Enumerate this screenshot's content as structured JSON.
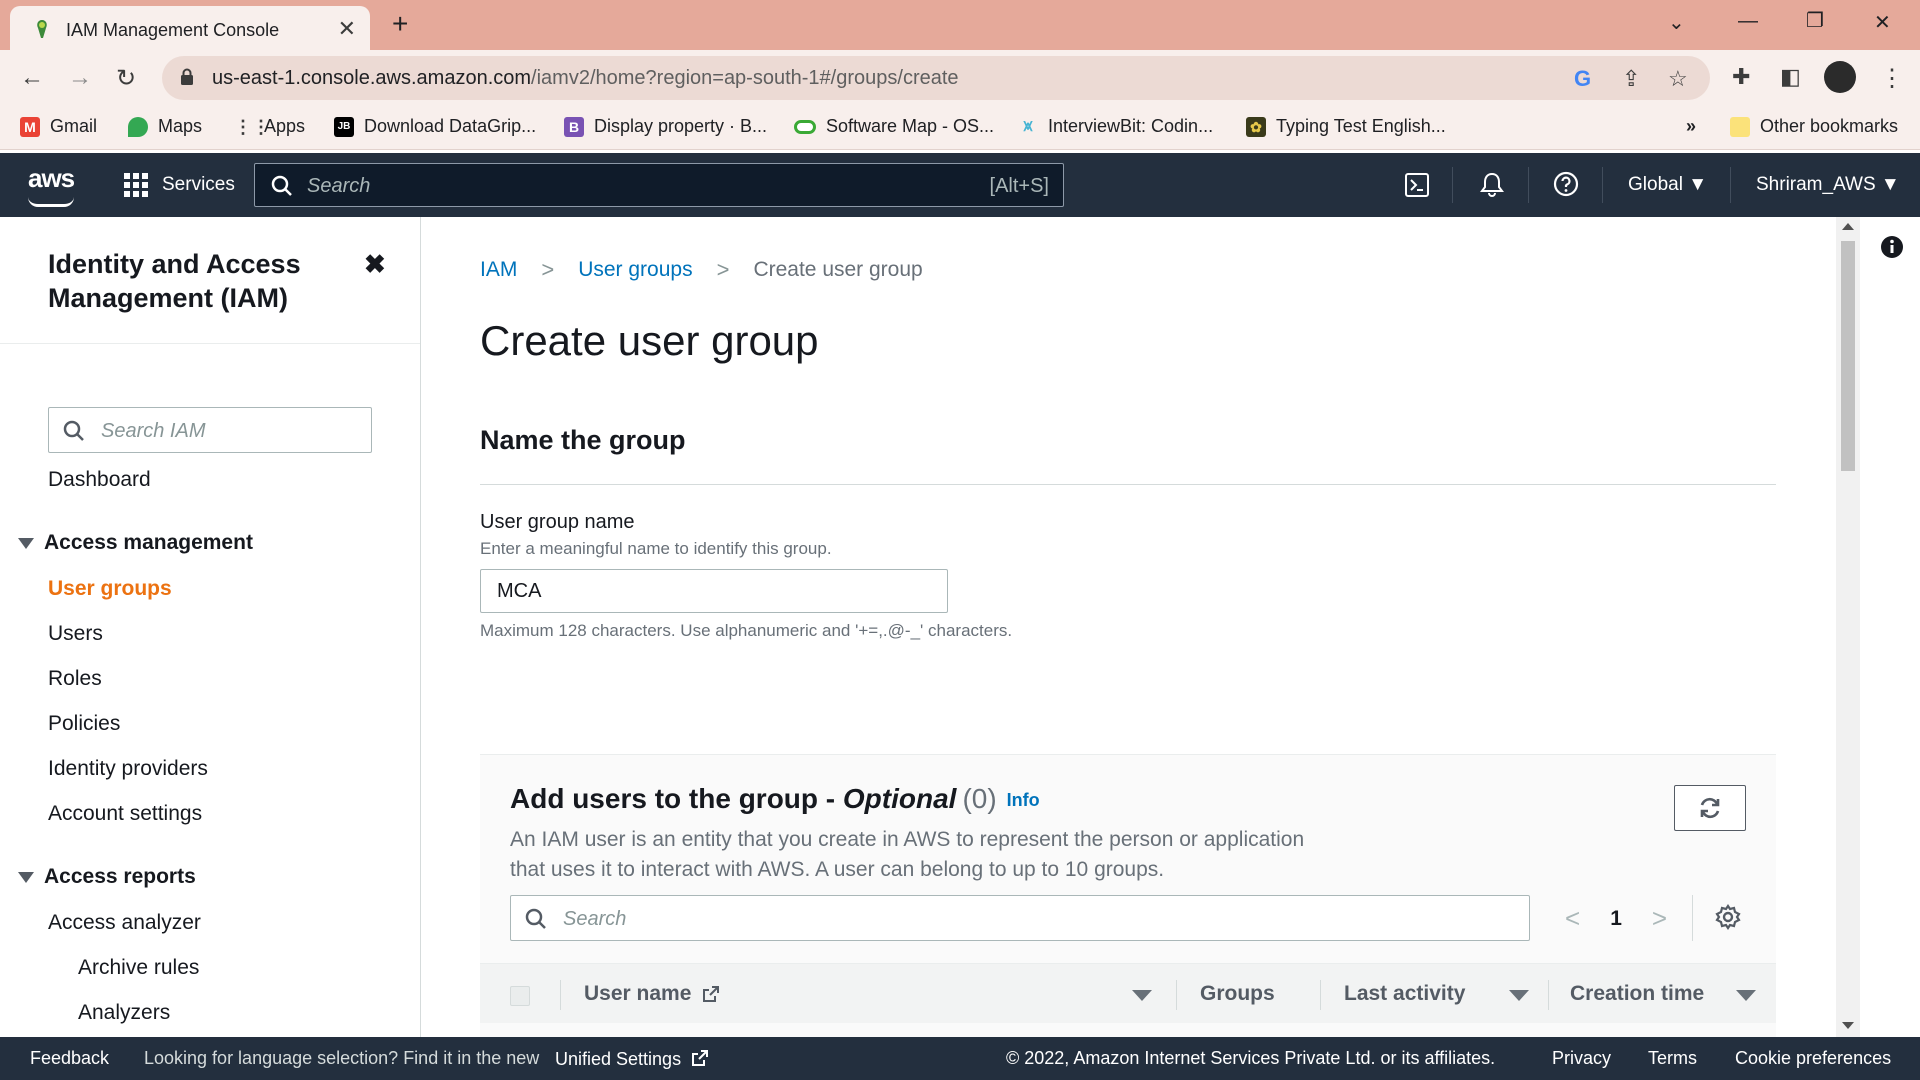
{
  "browser": {
    "tab_title": "IAM Management Console",
    "url_host": "us-east-1.console.aws.amazon.com",
    "url_path": "/iamv2/home?region=ap-south-1#/groups/create",
    "bookmarks": [
      {
        "label": "Gmail",
        "icon": "gmail-icon",
        "color": "#ea4335"
      },
      {
        "label": "Maps",
        "icon": "maps-icon",
        "color": "#34a853"
      },
      {
        "label": "Apps",
        "icon": "apps-grid-icon",
        "color": "#3c3c3c"
      },
      {
        "label": "Download DataGrip...",
        "icon": "jetbrains-icon",
        "color": "#000000"
      },
      {
        "label": "Display property · B...",
        "icon": "bootstrap-icon",
        "color": "#7952b3"
      },
      {
        "label": "Software Map - OS...",
        "icon": "osi-icon",
        "color": "#3aa935"
      },
      {
        "label": "InterviewBit: Codin...",
        "icon": "interviewbit-icon",
        "color": "#47b4d3"
      },
      {
        "label": "Typing Test English...",
        "icon": "typingtest-icon",
        "color": "#3a3a1a"
      }
    ],
    "more_bookmarks": "»",
    "other_bookmarks": "Other bookmarks"
  },
  "aws_header": {
    "logo": "aws",
    "services": "Services",
    "search_placeholder": "Search",
    "search_shortcut": "[Alt+S]",
    "region": "Global ▼",
    "account": "Shriram_AWS ▼"
  },
  "sidenav": {
    "title": "Identity and Access Management (IAM)",
    "search_placeholder": "Search IAM",
    "dashboard": "Dashboard",
    "access_management": "Access management",
    "access_items": [
      "User groups",
      "Users",
      "Roles",
      "Policies",
      "Identity providers",
      "Account settings"
    ],
    "access_reports": "Access reports",
    "report_items": [
      "Access analyzer"
    ],
    "report_subitems": [
      "Archive rules",
      "Analyzers"
    ]
  },
  "main": {
    "breadcrumbs": {
      "root": "IAM",
      "parent": "User groups",
      "current": "Create user group"
    },
    "page_title": "Create user group",
    "name_section": {
      "title": "Name the group",
      "field_label": "User group name",
      "field_description": "Enter a meaningful name to identify this group.",
      "field_value": "MCA",
      "field_hint": "Maximum 128 characters. Use alphanumeric and '+=,.@-_' characters."
    },
    "users_section": {
      "title_main": "Add users to the group - ",
      "title_optional": "Optional",
      "count": "(0)",
      "info": "Info",
      "description": "An IAM user is an entity that you create in AWS to represent the person or application that uses it to interact with AWS. A user can belong to up to 10 groups.",
      "search_placeholder": "Search",
      "page_number": "1",
      "columns": [
        "User name",
        "Groups",
        "Last activity",
        "Creation time"
      ]
    }
  },
  "footer": {
    "feedback": "Feedback",
    "language_prompt": "Looking for language selection? Find it in the new",
    "unified_settings": "Unified Settings",
    "copyright": "© 2022, Amazon Internet Services Private Ltd. or its affiliates.",
    "privacy": "Privacy",
    "terms": "Terms",
    "cookie_preferences": "Cookie preferences"
  }
}
